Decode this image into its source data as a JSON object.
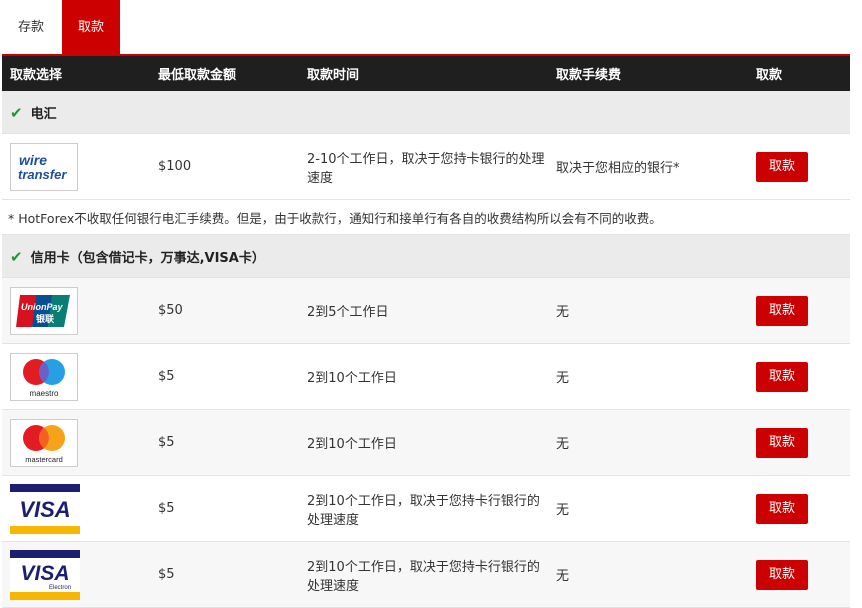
{
  "tabs": {
    "deposit": "存款",
    "withdraw": "取款"
  },
  "columns": [
    "取款选择",
    "最低取款金额",
    "取款时间",
    "取款手续费",
    "取款"
  ],
  "groups": {
    "wire": "电汇",
    "cards": "信用卡（包含借记卡，万事达,VISA卡）"
  },
  "wire_row": {
    "logo": "wire-transfer-logo",
    "logo_text_1": "wire",
    "logo_text_2": "transfer",
    "min": "$100",
    "time": "2-10个工作日，取决于您持卡银行的处理速度",
    "fee": "取决于您相应的银行*",
    "button": "取款"
  },
  "note": "* HotForex不收取任何银行电汇手续费。但是，由于收款行，通知行和接单行有各自的收费结构所以会有不同的收费。",
  "card_rows": [
    {
      "logo": "unionpay-logo",
      "logo_text_1": "UnionPay",
      "logo_text_2": "银联",
      "min": "$50",
      "time": "2到5个工作日",
      "fee": "无",
      "button": "取款"
    },
    {
      "logo": "maestro-logo",
      "logo_text_1": "maestro",
      "min": "$5",
      "time": "2到10个工作日",
      "fee": "无",
      "button": "取款"
    },
    {
      "logo": "mastercard-logo",
      "logo_text_1": "mastercard",
      "min": "$5",
      "time": "2到10个工作日",
      "fee": "无",
      "button": "取款"
    },
    {
      "logo": "visa-logo",
      "logo_text_1": "VISA",
      "min": "$5",
      "time": "2到10个工作日，取决于您持卡行银行的处理速度",
      "fee": "无",
      "button": "取款"
    },
    {
      "logo": "visa-electron-logo",
      "logo_text_1": "VISA",
      "logo_text_2": "Electron",
      "min": "$5",
      "time": "2到10个工作日，取决于您持卡行银行的处理速度",
      "fee": "无",
      "button": "取款"
    }
  ],
  "colors": {
    "accent": "#cc0000",
    "header_bg": "#1f1f1f",
    "check": "#1a9a3a"
  }
}
